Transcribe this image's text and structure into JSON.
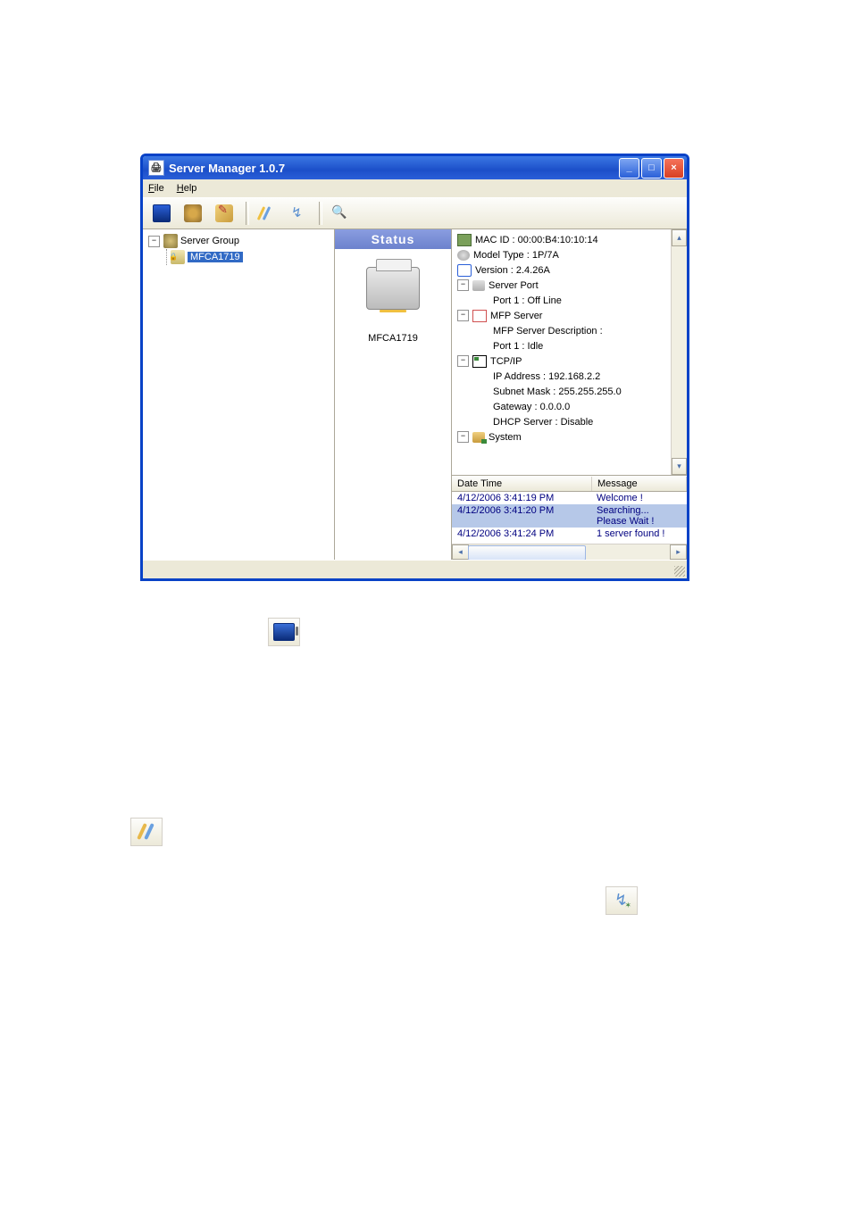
{
  "window": {
    "title": "Server Manager 1.0.7",
    "menu": {
      "file": "File",
      "help": "Help"
    }
  },
  "tree": {
    "root": "Server Group",
    "server": "MFCA1719"
  },
  "status": {
    "header": "Status",
    "device": "MFCA1719"
  },
  "details": {
    "mac": "MAC ID : 00:00:B4:10:10:14",
    "model": "Model Type : 1P/7A",
    "version": "Version : 2.4.26A",
    "serverport": "Server Port",
    "port1_off": "Port 1 : Off Line",
    "mfp": "MFP Server",
    "mfp_desc": "MFP Server Description :",
    "mfp_port": "Port 1 : Idle",
    "tcp": "TCP/IP",
    "ip": "IP Address : 192.168.2.2",
    "subnet": "Subnet Mask : 255.255.255.0",
    "gateway": "Gateway : 0.0.0.0",
    "dhcp": "DHCP Server : Disable",
    "system": "System"
  },
  "log": {
    "col_dt": "Date Time",
    "col_msg": "Message",
    "rows": [
      {
        "dt": "4/12/2006 3:41:19 PM",
        "msg": "Welcome !"
      },
      {
        "dt": "4/12/2006 3:41:20 PM",
        "msg": "Searching... Please Wait !"
      },
      {
        "dt": "4/12/2006 3:41:24 PM",
        "msg": "1 server found !"
      }
    ]
  }
}
